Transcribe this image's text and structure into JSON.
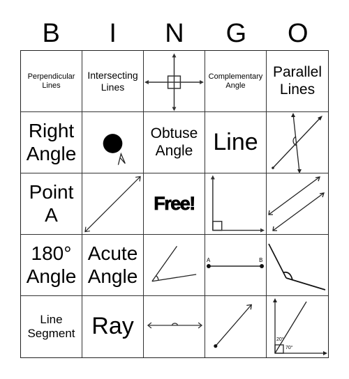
{
  "header": {
    "letters": [
      "B",
      "I",
      "N",
      "G",
      "O"
    ]
  },
  "cells": [
    {
      "type": "text",
      "text": "Perpendicular Lines",
      "size": "xs"
    },
    {
      "type": "text",
      "text": "Intersecting Lines",
      "size": "sm"
    },
    {
      "type": "image",
      "icon": "perpendicular-lines-diagram"
    },
    {
      "type": "text",
      "text": "Complementary Angle",
      "size": "xs"
    },
    {
      "type": "text",
      "text": "Parallel Lines",
      "size": "lg"
    },
    {
      "type": "text",
      "text": "Right Angle",
      "size": "xl"
    },
    {
      "type": "image",
      "icon": "point-a-diagram"
    },
    {
      "type": "text",
      "text": "Obtuse Angle",
      "size": "lg"
    },
    {
      "type": "text",
      "text": "Line",
      "size": "xxl"
    },
    {
      "type": "image",
      "icon": "intersecting-lines-diagram"
    },
    {
      "type": "text",
      "text": "Point A",
      "size": "xl"
    },
    {
      "type": "image",
      "icon": "line-diagram"
    },
    {
      "type": "free",
      "text": "Free!"
    },
    {
      "type": "image",
      "icon": "right-angle-diagram"
    },
    {
      "type": "image",
      "icon": "parallel-lines-diagram"
    },
    {
      "type": "text",
      "text": "180° Angle",
      "size": "xl"
    },
    {
      "type": "text",
      "text": "Acute Angle",
      "size": "xl"
    },
    {
      "type": "image",
      "icon": "acute-angle-diagram"
    },
    {
      "type": "image",
      "icon": "line-segment-diagram",
      "labels": [
        "A",
        "B"
      ]
    },
    {
      "type": "image",
      "icon": "obtuse-angle-diagram"
    },
    {
      "type": "text",
      "text": "Line Segment",
      "size": "md"
    },
    {
      "type": "text",
      "text": "Ray",
      "size": "xxl"
    },
    {
      "type": "image",
      "icon": "straight-angle-diagram"
    },
    {
      "type": "image",
      "icon": "ray-diagram"
    },
    {
      "type": "image",
      "icon": "complementary-angle-diagram",
      "labels": [
        "20°",
        "70°"
      ]
    }
  ]
}
